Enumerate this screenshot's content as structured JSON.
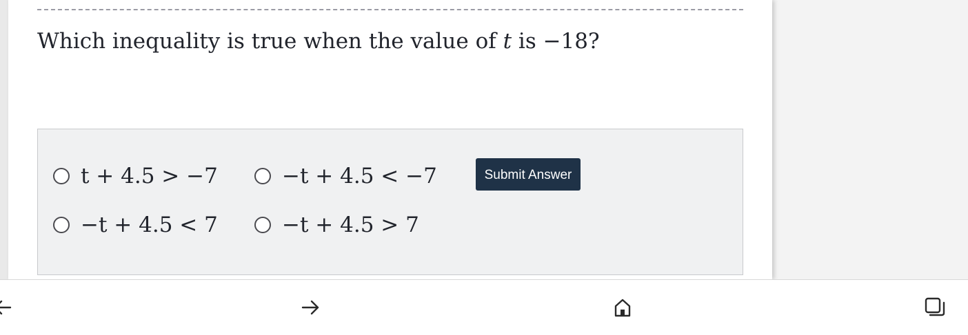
{
  "question": {
    "prefix": "Which inequality is true when the value of ",
    "variable": "t",
    "middle": " is ",
    "value": "−18",
    "suffix": "?"
  },
  "choices": [
    {
      "label": "t + 4.5 > −7"
    },
    {
      "label": "−t + 4.5 < −7"
    },
    {
      "label": "−t + 4.5 < 7"
    },
    {
      "label": "−t + 4.5 > 7"
    }
  ],
  "submit_label": "Submit Answer",
  "colors": {
    "submit_bg": "#1f3247",
    "answer_box_bg": "#f0f1f2",
    "text": "#21242c"
  },
  "bottom_nav": {
    "icons": [
      "back-arrow-icon",
      "forward-arrow-icon",
      "home-icon",
      "tabs-icon"
    ]
  }
}
